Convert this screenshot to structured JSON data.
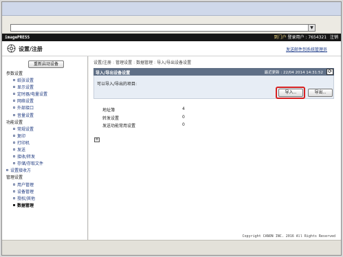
{
  "brand": "imagePRESS",
  "topbar": {
    "portal": "到门户",
    "login_user_label": "登录用户",
    "login_user_value": "7654321",
    "logout": "注销"
  },
  "header": {
    "title": "设置/注册",
    "mail_link": "发送邮件到系统管理员"
  },
  "sidebar": {
    "restart_label": "重新启动设备",
    "items": [
      {
        "label": "参数设置",
        "kind": "head"
      },
      {
        "label": "纸张设置",
        "kind": "item"
      },
      {
        "label": "显示设置",
        "kind": "item"
      },
      {
        "label": "定时器/电量设置",
        "kind": "item"
      },
      {
        "label": "网络设置",
        "kind": "item"
      },
      {
        "label": "外部接口",
        "kind": "item"
      },
      {
        "label": "音量设置",
        "kind": "item"
      },
      {
        "label": "功能设置",
        "kind": "head"
      },
      {
        "label": "常规设置",
        "kind": "item"
      },
      {
        "label": "复印",
        "kind": "item"
      },
      {
        "label": "打印机",
        "kind": "item"
      },
      {
        "label": "发送",
        "kind": "item"
      },
      {
        "label": "接收/转发",
        "kind": "item"
      },
      {
        "label": "存储/存取文件",
        "kind": "item"
      },
      {
        "label": "设置接收方",
        "kind": "top"
      },
      {
        "label": "管理设置",
        "kind": "head"
      },
      {
        "label": "用户管理",
        "kind": "item"
      },
      {
        "label": "设备管理",
        "kind": "item"
      },
      {
        "label": "授权/其他",
        "kind": "item"
      },
      {
        "label": "数据管理",
        "kind": "item",
        "active": true
      }
    ]
  },
  "breadcrumb": [
    "设置/注册",
    "管理设置",
    "数据管理",
    "导入/导出设备设置"
  ],
  "breadcrumb_sep": ":",
  "panel": {
    "title": "导入/导出设备设置",
    "updated_label": "最近更新",
    "updated_value": "22/04 2014 14:31:52",
    "description": "可以导入/导出的项目:",
    "import_label": "导入...",
    "export_label": "导出..."
  },
  "info_rows": [
    {
      "label": "地址簿",
      "value": "4"
    },
    {
      "label": "转发设置",
      "value": "0"
    },
    {
      "label": "发送功能常用设置",
      "value": "0"
    }
  ],
  "copyright": "Copyright CANON INC. 2016 All Rights Reserved",
  "colors": {
    "panel_header": "#5f6f86",
    "panel_body": "#e7edf5",
    "highlight": "#d62020",
    "link": "#1d3c8a"
  },
  "icons": {
    "address_dropdown": "chevron-down-icon",
    "header_icon": "settings-tool-icon",
    "refresh": "refresh-icon",
    "page_top": "page-top-icon"
  }
}
